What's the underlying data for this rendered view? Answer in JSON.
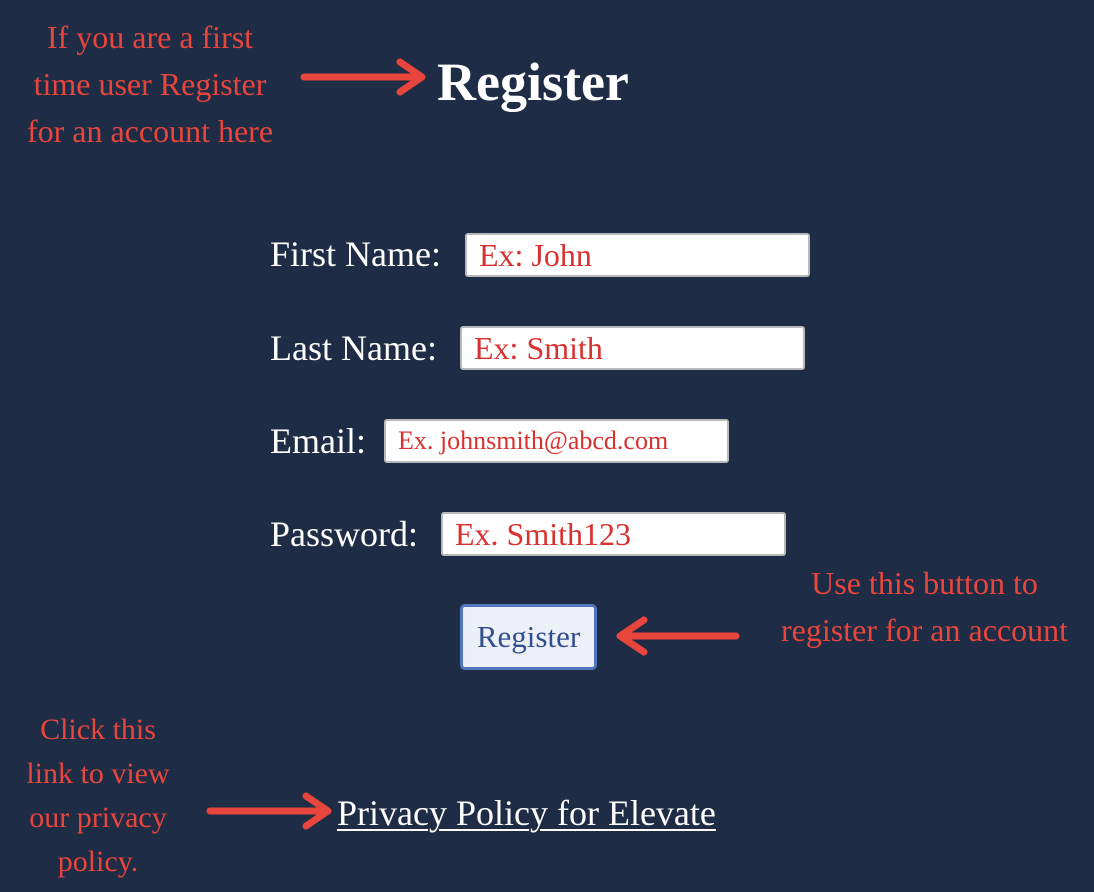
{
  "annotations": {
    "top": [
      "If you are a first",
      "time user Register",
      "for an account here"
    ],
    "button": [
      "Use this button to",
      "register for an account"
    ],
    "privacy": [
      "Click this",
      "link to view",
      "our privacy",
      "policy."
    ]
  },
  "header": {
    "title": "Register"
  },
  "form": {
    "first_name": {
      "label": "First Name:",
      "placeholder": "Ex: John"
    },
    "last_name": {
      "label": "Last Name:",
      "placeholder": "Ex: Smith"
    },
    "email": {
      "label": "Email:",
      "placeholder": "Ex. johnsmith@abcd.com"
    },
    "password": {
      "label": "Password:",
      "placeholder": "Ex. Smith123"
    },
    "submit_label": "Register"
  },
  "footer": {
    "privacy_link": "Privacy Policy for Elevate"
  },
  "colors": {
    "background": "#1e2c45",
    "annotation": "#e8453c",
    "button_border": "#5277c0"
  }
}
